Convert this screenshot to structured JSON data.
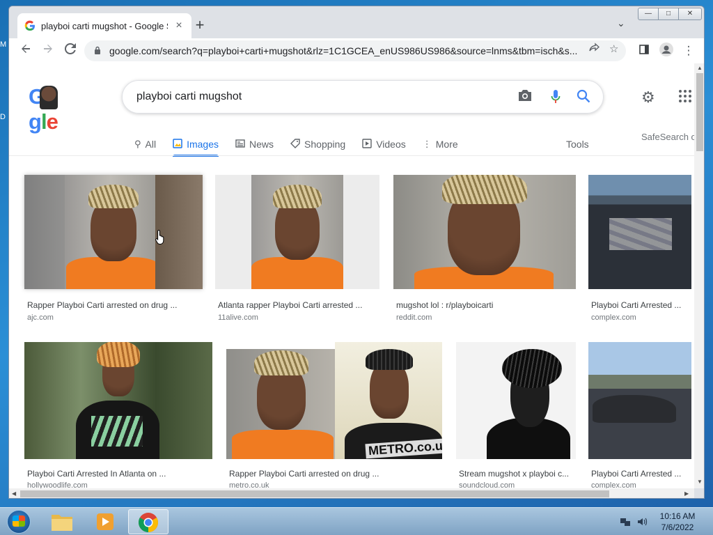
{
  "desktop": {
    "edge_top": "M",
    "edge_mid": "D"
  },
  "browser": {
    "tab_title": "playboi carti mugshot - Google S",
    "new_tab": "+",
    "tab_list": "⌄",
    "window_controls": {
      "minimize": "—",
      "maximize": "□",
      "close": "✕"
    },
    "url": "google.com/search?q=playboi+carti+mugshot&rlz=1C1GCEA_enUS986US986&source=lnms&tbm=isch&s..."
  },
  "google": {
    "logo_text": "Google",
    "search_value": "playboi carti mugshot",
    "nav": [
      {
        "label": "All",
        "icon": "search-icon",
        "active": false
      },
      {
        "label": "Images",
        "icon": "image-icon",
        "active": true
      },
      {
        "label": "News",
        "icon": "news-icon",
        "active": false
      },
      {
        "label": "Shopping",
        "icon": "tag-icon",
        "active": false
      },
      {
        "label": "Videos",
        "icon": "play-icon",
        "active": false
      },
      {
        "label": "More",
        "icon": "kebab-icon",
        "active": false
      }
    ],
    "tools": "Tools",
    "safesearch": "SafeSearch o"
  },
  "results": [
    {
      "caption": "Rapper Playboi Carti arrested on drug ...",
      "source": "ajc.com"
    },
    {
      "caption": "Atlanta rapper Playboi Carti arrested ...",
      "source": "11alive.com"
    },
    {
      "caption": "mugshot lol : r/playboicarti",
      "source": "reddit.com"
    },
    {
      "caption": "Playboi Carti Arrested ...",
      "source": "complex.com"
    },
    {
      "caption": "Playboi Carti Arrested In Atlanta on ...",
      "source": "hollywoodlife.com"
    },
    {
      "caption": "Rapper Playboi Carti arrested on drug ...",
      "source": "metro.co.uk",
      "overlay": "METRO.co.uk"
    },
    {
      "caption": "Stream mugshot x playboi c...",
      "source": "soundcloud.com"
    },
    {
      "caption": "Playboi Carti Arrested ...",
      "source": "complex.com"
    }
  ],
  "taskbar": {
    "time": "10:16 AM",
    "date": "7/6/2022"
  },
  "colors": {
    "google_blue": "#1a73e8",
    "accent_orange": "#f07b21"
  }
}
